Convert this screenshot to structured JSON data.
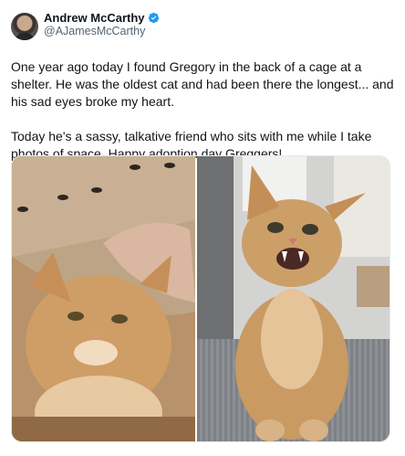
{
  "author": {
    "display_name": "Andrew McCarthy",
    "handle": "@AJamesMcCarthy",
    "verified_color": "#1d9bf0"
  },
  "post": {
    "paragraph_1": "One year ago today I found Gregory in the back of a cage at a shelter. He was the oldest cat and had been there the longest... and his sad eyes broke my heart.",
    "paragraph_2": "Today he's a sassy, talkative friend who sits with me while I take photos of space. Happy adoption day Greggers!"
  },
  "media": {
    "photos": [
      {
        "subject": "orange cat in cardboard carrier"
      },
      {
        "subject": "orange cat sitting on mat"
      }
    ]
  }
}
